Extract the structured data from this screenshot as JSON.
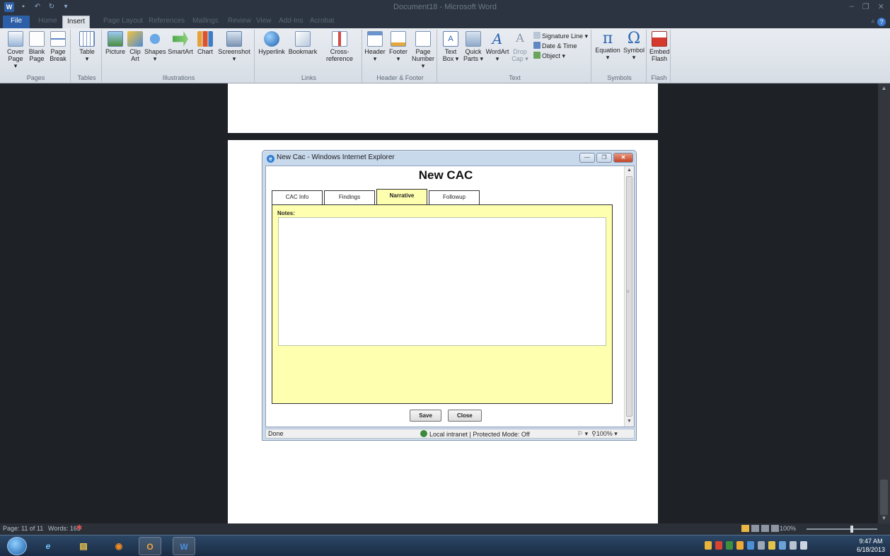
{
  "app": {
    "title": "Document18 - Microsoft Word"
  },
  "ribbon": {
    "tabs": [
      "File",
      "Home",
      "Insert",
      "Page Layout",
      "References",
      "Mailings",
      "Review",
      "View",
      "Add-Ins",
      "Acrobat"
    ],
    "active_tab": "Insert",
    "groups": {
      "pages": {
        "label": "Pages",
        "cover": "Cover\nPage ▾",
        "blank": "Blank\nPage",
        "break": "Page\nBreak"
      },
      "tables": {
        "label": "Tables",
        "table": "Table\n▾"
      },
      "illustrations": {
        "label": "Illustrations",
        "picture": "Picture",
        "clipart": "Clip\nArt",
        "shapes": "Shapes\n▾",
        "smartart": "SmartArt",
        "chart": "Chart",
        "screenshot": "Screenshot\n▾"
      },
      "links": {
        "label": "Links",
        "hyperlink": "Hyperlink",
        "bookmark": "Bookmark",
        "crossref": "Cross-reference"
      },
      "header_footer": {
        "label": "Header & Footer",
        "header": "Header\n▾",
        "footer": "Footer\n▾",
        "page_number": "Page\nNumber ▾"
      },
      "text": {
        "label": "Text",
        "textbox": "Text\nBox ▾",
        "quickparts": "Quick\nParts ▾",
        "wordart": "WordArt\n▾",
        "dropcap": "Drop\nCap ▾",
        "signature": "Signature Line ▾",
        "datetime": "Date & Time",
        "object": "Object ▾"
      },
      "symbols": {
        "label": "Symbols",
        "equation": "Equation\n▾",
        "symbol": "Symbol\n▾"
      },
      "flash": {
        "label": "Flash",
        "embed": "Embed\nFlash"
      }
    }
  },
  "ie_window": {
    "title": "New Cac - Windows Internet Explorer",
    "status": {
      "done": "Done",
      "zone": "Local intranet | Protected Mode: Off",
      "zoom": "100%"
    }
  },
  "cac_form": {
    "title": "New CAC",
    "tabs": [
      "CAC Info",
      "Findings",
      "Narrative",
      "Followup"
    ],
    "active_tab": "Narrative",
    "notes_label": "Notes:",
    "notes_value": "",
    "save_label": "Save",
    "close_label": "Close"
  },
  "word_status": {
    "page": "Page: 11 of 11",
    "words": "Words: 165",
    "zoom": "100%"
  },
  "taskbar": {
    "time": "9:47 AM",
    "date": "6/18/2013"
  },
  "colors": {
    "panel_yellow": "#ffffb0",
    "word_blue": "#2d5fa8",
    "doc_background": "#1e2126"
  }
}
